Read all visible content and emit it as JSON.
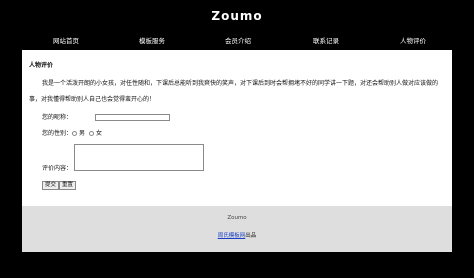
{
  "logo": "Zoumo",
  "nav": [
    "网站首页",
    "模板服务",
    "会员介绍",
    "联系记录",
    "人物评价"
  ],
  "form": {
    "heading": "人物评价",
    "para1": "我是一个活泼开朗的小女孩，对任性随和，下课后总能听到我爽快的笑声，对下课后到时会帮拥堵不好的同学讲一下题，对还会帮助别人做对应该做的",
    "para2": "事，对我懂得帮助别人自己也会觉得蛮开心的！",
    "name_label": "您的昵称：",
    "gender_label": "您的性别：",
    "gender_options": [
      "男",
      "女"
    ],
    "comment_label": "评价内容：",
    "submit_label": "提交",
    "reset_label": "重置"
  },
  "footer": {
    "title": "Zoumo",
    "credit_link": "周氏模板网",
    "credit_suffix": "出品"
  }
}
